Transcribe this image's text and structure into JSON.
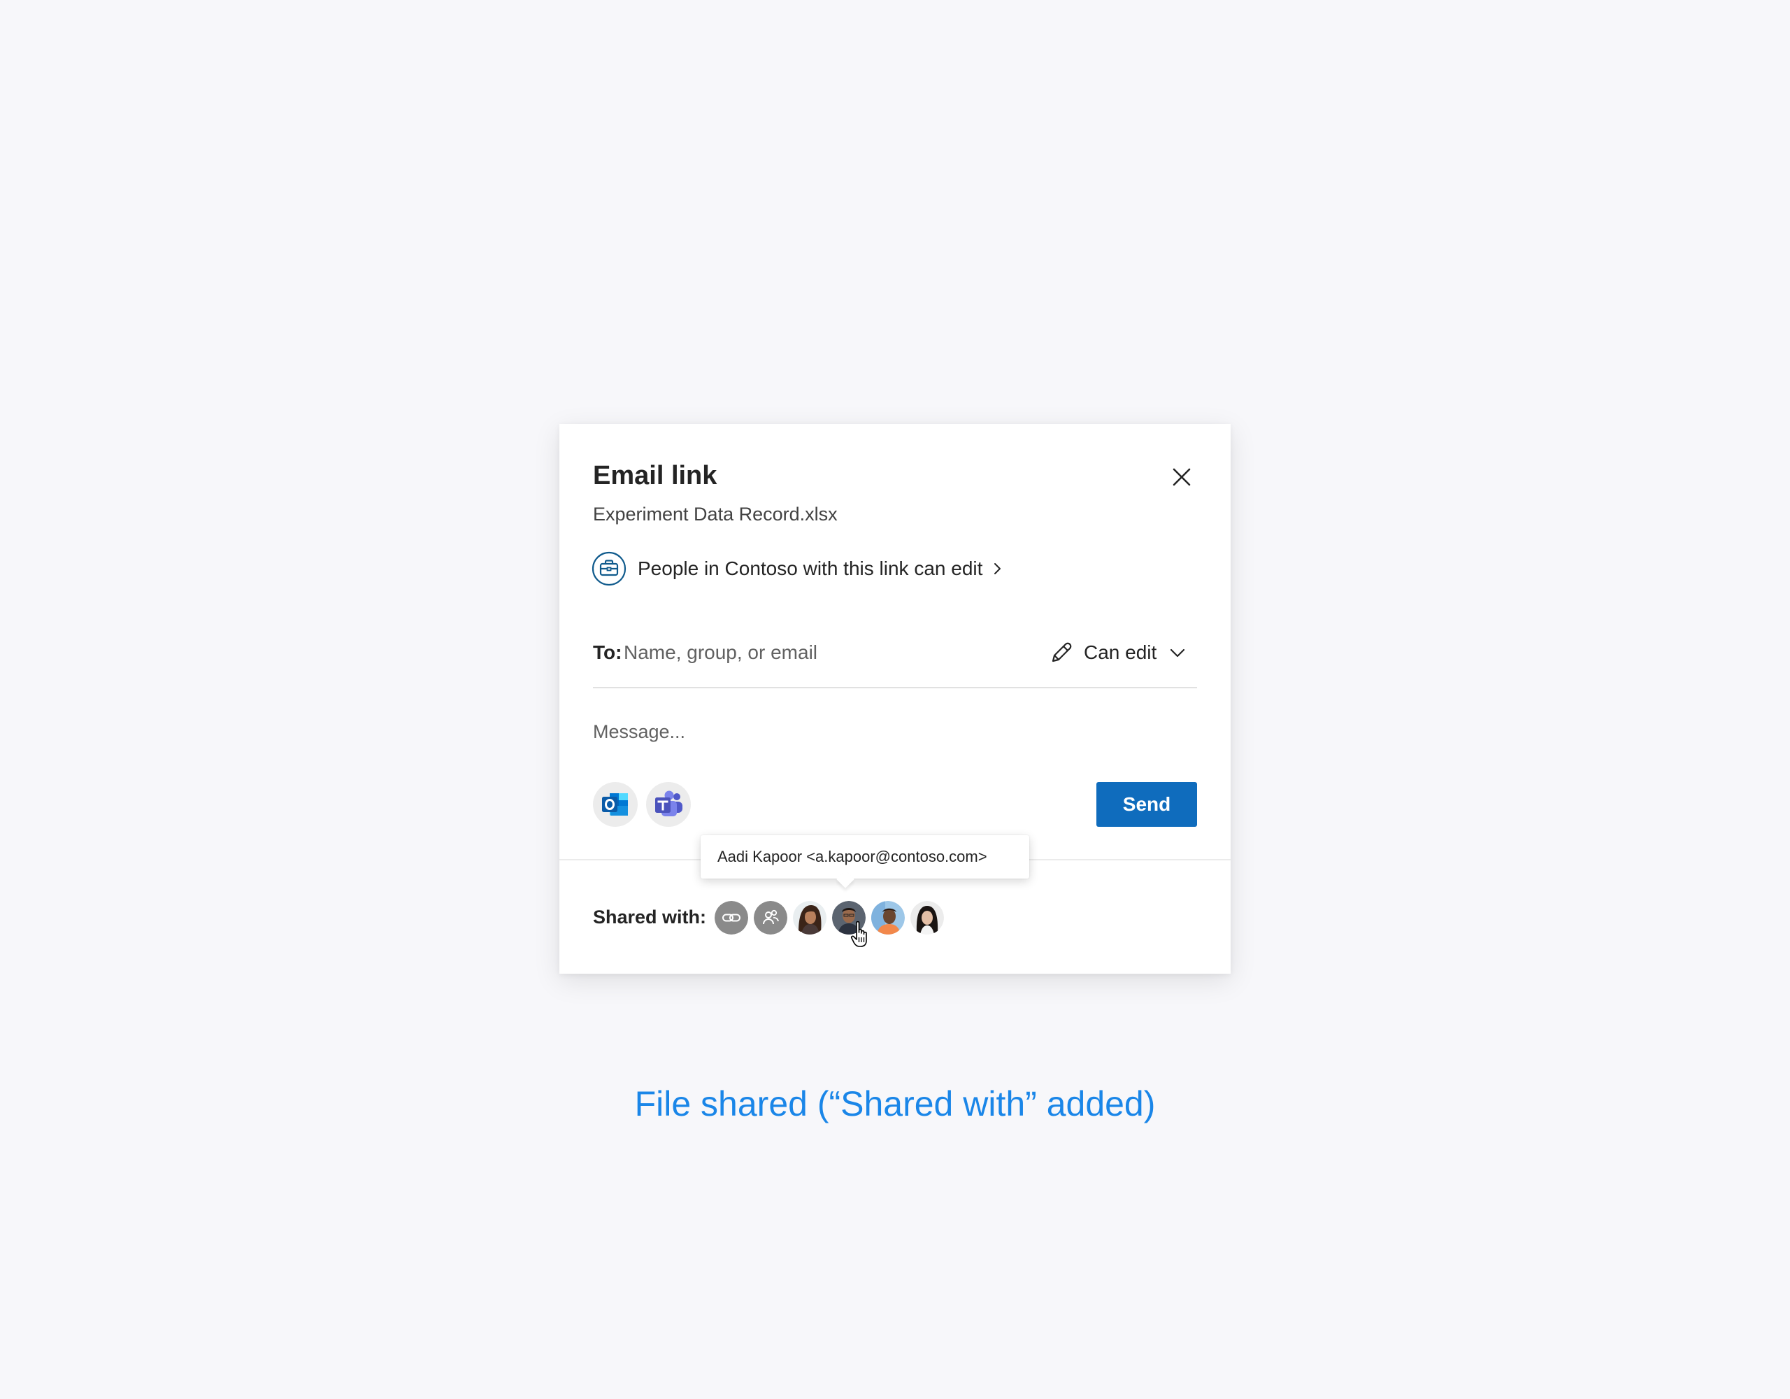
{
  "colors": {
    "page_background": "#f7f7fa",
    "accent": "#0f6cbd",
    "caption": "#1a86e8"
  },
  "dialog": {
    "title": "Email link",
    "file_name": "Experiment Data Record.xlsx",
    "link_setting": {
      "icon": "briefcase-icon",
      "label": "People in Contoso with this link can edit"
    },
    "to": {
      "label": "To:",
      "placeholder": "Name, group, or email",
      "value": ""
    },
    "permission": {
      "icon": "pencil-icon",
      "label": "Can edit"
    },
    "message": {
      "placeholder": "Message...",
      "value": ""
    },
    "apps": [
      {
        "name": "Outlook",
        "icon": "outlook-icon"
      },
      {
        "name": "Teams",
        "icon": "teams-icon"
      }
    ],
    "send_label": "Send",
    "close_icon": "close-icon",
    "shared_with": {
      "label": "Shared with:",
      "avatars": [
        {
          "kind": "link",
          "icon": "link-icon"
        },
        {
          "kind": "group",
          "icon": "people-icon"
        },
        {
          "kind": "person"
        },
        {
          "kind": "person",
          "hovered": true
        },
        {
          "kind": "person"
        },
        {
          "kind": "person"
        }
      ],
      "tooltip": "Aadi Kapoor <a.kapoor@contoso.com>"
    }
  },
  "caption": "File shared (“Shared with” added)"
}
